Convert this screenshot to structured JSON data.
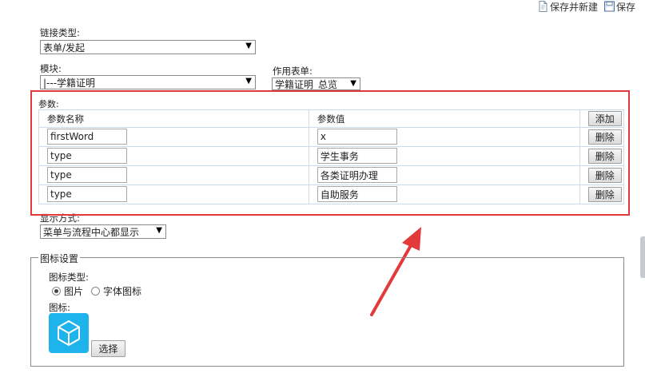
{
  "toolbar": {
    "save_new_label": "保存并新建",
    "save_label": "保存"
  },
  "link_type": {
    "label": "链接类型:",
    "value": "表单/发起"
  },
  "module": {
    "label": "模块:",
    "value": "|---学籍证明"
  },
  "action_form": {
    "label": "作用表单:",
    "value": "学籍证明_总览"
  },
  "params": {
    "label": "参数:",
    "col_name": "参数名称",
    "col_value": "参数值",
    "add_label": "添加",
    "rows": [
      {
        "name": "firstWord",
        "value": "x",
        "delete_label": "删除"
      },
      {
        "name": "type",
        "value": "学生事务",
        "delete_label": "删除"
      },
      {
        "name": "type",
        "value": "各类证明办理",
        "delete_label": "删除"
      },
      {
        "name": "type",
        "value": "自助服务",
        "delete_label": "删除"
      }
    ]
  },
  "display_mode": {
    "label": "显示方式:",
    "value": "菜单与流程中心都显示"
  },
  "icon_settings": {
    "legend": "图标设置",
    "type_label": "图标类型:",
    "option_image": "图片",
    "option_font": "字体图标",
    "selected": "图片",
    "icon_label": "图标:",
    "icon_name": "cube-icon",
    "icon_color": "#1eb3ea",
    "choose_label": "选择"
  },
  "annotation": {
    "highlight_color": "#e23a3a"
  }
}
